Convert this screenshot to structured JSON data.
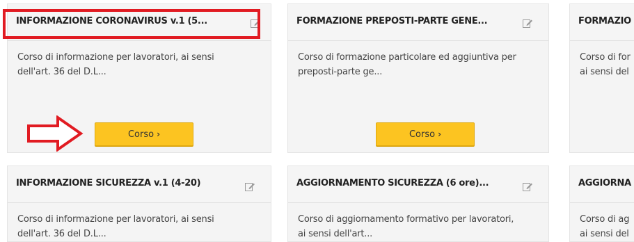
{
  "cards": [
    {
      "title": "INFORMAZIONE CORONAVIRUS v.1 (5...",
      "desc_line1": "Corso di informazione per lavoratori, ai sensi",
      "desc_line2": "dell'art. 36 del D.L...",
      "button_label": "Corso",
      "button_chevron": "›"
    },
    {
      "title": "FORMAZIONE PREPOSTI-PARTE GENE...",
      "desc_line1": "Corso di formazione particolare ed aggiuntiva per",
      "desc_line2": "preposti-parte ge...",
      "button_label": "Corso",
      "button_chevron": "›"
    },
    {
      "title": "FORMAZIO",
      "desc_line1": "Corso di for",
      "desc_line2": "ai sensi del"
    },
    {
      "title": "INFORMAZIONE SICUREZZA v.1 (4-20)",
      "desc_line1": "Corso di informazione per lavoratori, ai sensi",
      "desc_line2": "dell'art. 36 del D.L..."
    },
    {
      "title": "AGGIORNAMENTO SICUREZZA (6 ore)...",
      "desc_line1": "Corso di aggiornamento formativo per lavoratori,",
      "desc_line2": "ai sensi dell'art..."
    },
    {
      "title": "AGGIORNA",
      "desc_line1": "Corso di ag",
      "desc_line2": "ai sensi del"
    }
  ],
  "colors": {
    "button_yellow": "#fcc421",
    "highlight_red": "#e11b22",
    "card_bg": "#f4f4f4"
  },
  "annotations": {
    "highlight": "red-rectangle",
    "pointer": "red-outline-arrow"
  }
}
